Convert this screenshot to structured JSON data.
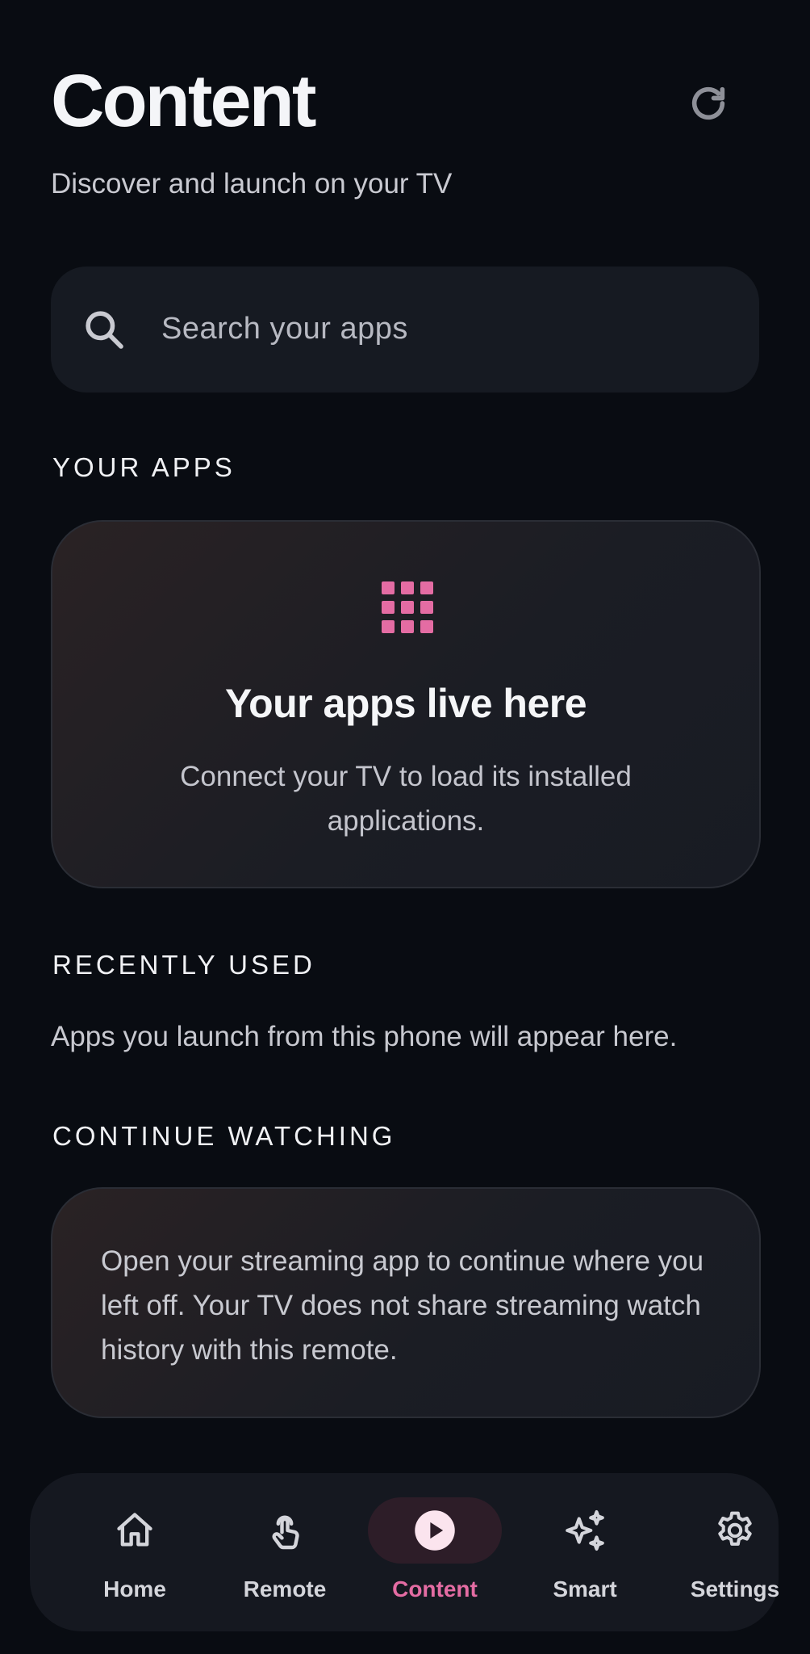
{
  "header": {
    "title": "Content",
    "subtitle": "Discover and launch on your TV",
    "refresh_icon": "refresh-icon"
  },
  "search": {
    "placeholder": "Search your apps",
    "icon": "search-icon"
  },
  "sections": {
    "your_apps": {
      "label": "YOUR APPS",
      "empty_icon": "app-grid-icon",
      "empty_title": "Your apps live here",
      "empty_description": "Connect your TV to load its installed applications."
    },
    "recently_used": {
      "label": "RECENTLY USED",
      "empty_text": "Apps you launch from this phone will appear here."
    },
    "continue_watching": {
      "label": "CONTINUE WATCHING",
      "message": "Open your streaming app to continue where you left off. Your TV does not share streaming watch history with this remote."
    }
  },
  "nav": {
    "active": "Content",
    "items": [
      {
        "label": "Home",
        "icon": "home-icon"
      },
      {
        "label": "Remote",
        "icon": "touch-icon"
      },
      {
        "label": "Content",
        "icon": "play-icon"
      },
      {
        "label": "Smart",
        "icon": "sparkles-icon"
      },
      {
        "label": "Settings",
        "icon": "gear-icon"
      }
    ]
  },
  "colors": {
    "background": "#090c12",
    "accent": "#e46ca3",
    "card": "#1b1d24"
  }
}
